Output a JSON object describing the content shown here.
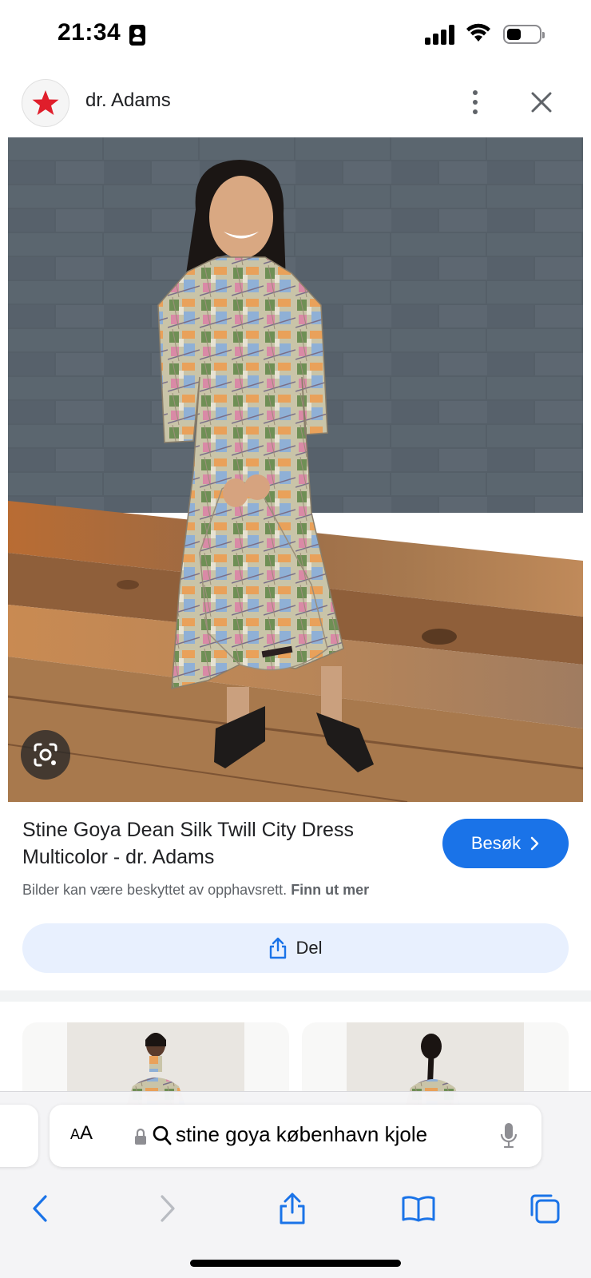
{
  "status_bar": {
    "time": "21:34",
    "icons": [
      "id-badge-icon",
      "cellular-signal-icon",
      "wifi-icon",
      "battery-icon"
    ]
  },
  "site": {
    "name": "dr. Adams",
    "logo_icon": "red-star-icon",
    "more_icon": "more-vert-icon",
    "close_icon": "close-icon"
  },
  "hero": {
    "lens_icon": "lens-search-icon"
  },
  "result": {
    "title": "Stine Goya Dean Silk Twill City Dress Multicolor - dr. Adams",
    "visit_label": "Besøk",
    "copyright_text": "Bilder kan være beskyttet av opphavsrett.",
    "learn_more": "Finn ut mer",
    "share_label": "Del"
  },
  "browser": {
    "aa_label": "AA",
    "url_text": "stine goya københavn kjole",
    "icons": [
      "lock-icon",
      "search-icon",
      "mic-icon",
      "back-icon",
      "forward-icon",
      "share-icon",
      "bookmarks-icon",
      "tabs-icon"
    ]
  },
  "colors": {
    "accent": "#1a73e8",
    "share_bg": "#e8f0fe",
    "logo_star": "#e01e2b"
  }
}
